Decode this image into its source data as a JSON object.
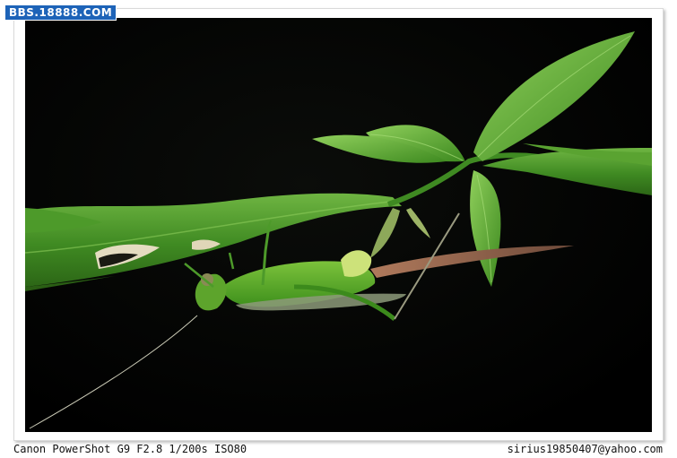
{
  "watermark": {
    "text": "BBS.18888.COM",
    "bg_color": "#1d63b8"
  },
  "photo": {
    "subject_icon": "katydid-on-leaf-photo"
  },
  "caption": {
    "camera_info": "Canon PowerShot G9 F2.8 1/200s ISO80",
    "email": "sirius19850407@yahoo.com"
  }
}
